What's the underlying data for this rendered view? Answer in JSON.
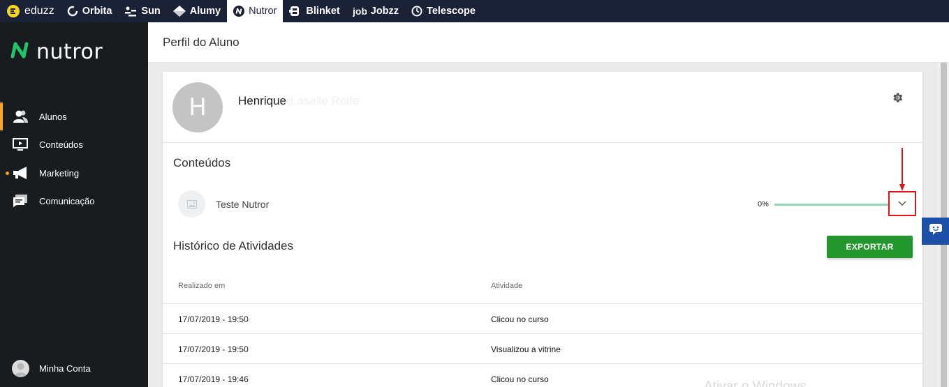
{
  "topbar": {
    "items": [
      {
        "label": "eduzz",
        "icon": "eduzz-logo-icon",
        "active": false
      },
      {
        "label": "Orbita",
        "icon": "orbita-icon",
        "active": false
      },
      {
        "label": "Sun",
        "icon": "sun-icon",
        "active": false
      },
      {
        "label": "Alumy",
        "icon": "alumy-icon",
        "active": false
      },
      {
        "label": "Nutror",
        "icon": "nutror-icon",
        "active": true
      },
      {
        "label": "Blinket",
        "icon": "blinket-icon",
        "active": false
      },
      {
        "label": "Jobzz",
        "icon": "jobzz-icon",
        "active": false
      },
      {
        "label": "Telescope",
        "icon": "telescope-icon",
        "active": false
      }
    ]
  },
  "sidebar": {
    "logo_text": "nutror",
    "items": [
      {
        "label": "Alunos",
        "icon": "students-icon",
        "active": true
      },
      {
        "label": "Conteúdos",
        "icon": "contents-icon",
        "active": false
      },
      {
        "label": "Marketing",
        "icon": "megaphone-icon",
        "active": false,
        "notify": true
      },
      {
        "label": "Comunicação",
        "icon": "chat-icon",
        "active": false
      }
    ],
    "account_label": "Minha Conta"
  },
  "header": {
    "title": "Perfil do Aluno"
  },
  "student": {
    "initial": "H",
    "first_name": "Henrique",
    "last_name_blurred": "Lasalle Rolfe"
  },
  "contents": {
    "title": "Conteúdos",
    "items": [
      {
        "name": "Teste Nutror",
        "progress_label": "0%",
        "progress": 0
      }
    ]
  },
  "history": {
    "title": "Histórico de Atividades",
    "export_label": "EXPORTAR",
    "columns": [
      "Realizado em",
      "Atividade"
    ],
    "rows": [
      {
        "date": "17/07/2019 - 19:50",
        "activity": "Clicou no curso"
      },
      {
        "date": "17/07/2019 - 19:50",
        "activity": "Visualizou a vitrine"
      },
      {
        "date": "17/07/2019 - 19:46",
        "activity": "Clicou no curso"
      }
    ]
  },
  "colors": {
    "topbar": "#1c2236",
    "sidebar": "#191c1e",
    "accent_orange": "#f5a623",
    "brand_green": "#23962e",
    "progress_track": "#8fd6b1",
    "annotation_red": "#e0121b",
    "chat_blue": "#1b4fa8"
  },
  "watermark": "Ativar o Windows"
}
